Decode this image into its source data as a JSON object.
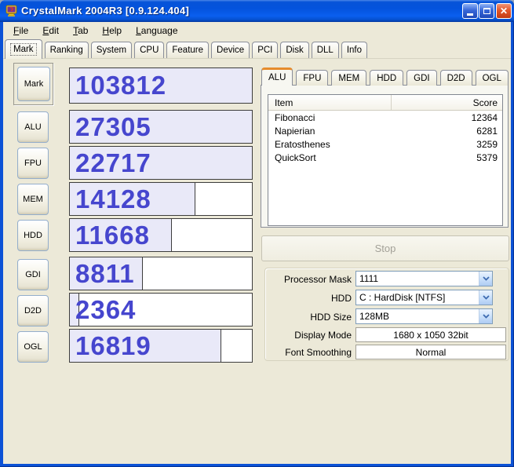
{
  "window": {
    "title": "CrystalMark 2004R3 [0.9.124.404]",
    "icons": {
      "close": "✕"
    }
  },
  "menu": {
    "items": [
      "File",
      "Edit",
      "Tab",
      "Help",
      "Language"
    ]
  },
  "main_tabs": {
    "active": "Mark",
    "items": [
      "Mark",
      "Ranking",
      "System",
      "CPU",
      "Feature",
      "Device",
      "PCI",
      "Disk",
      "DLL",
      "Info"
    ]
  },
  "benchmark": {
    "rows": [
      {
        "id": "mark",
        "label": "Mark",
        "score": "103812",
        "fill_pct": 100
      },
      {
        "id": "alu",
        "label": "ALU",
        "score": "27305",
        "fill_pct": 100
      },
      {
        "id": "fpu",
        "label": "FPU",
        "score": "22717",
        "fill_pct": 100
      },
      {
        "id": "mem",
        "label": "MEM",
        "score": "14128",
        "fill_pct": 69
      },
      {
        "id": "hdd",
        "label": "HDD",
        "score": "11668",
        "fill_pct": 56
      },
      {
        "id": "gdi",
        "label": "GDI",
        "score": "8811",
        "fill_pct": 40
      },
      {
        "id": "d2d",
        "label": "D2D",
        "score": "2364",
        "fill_pct": 5
      },
      {
        "id": "ogl",
        "label": "OGL",
        "score": "16819",
        "fill_pct": 83
      }
    ]
  },
  "detail": {
    "active_tab": "ALU",
    "tabs": [
      "ALU",
      "FPU",
      "MEM",
      "HDD",
      "GDI",
      "D2D",
      "OGL"
    ],
    "table": {
      "columns": [
        "Item",
        "Score"
      ],
      "rows": [
        {
          "item": "Fibonacci",
          "score": "12364"
        },
        {
          "item": "Napierian",
          "score": "6281"
        },
        {
          "item": "Eratosthenes",
          "score": "3259"
        },
        {
          "item": "QuickSort",
          "score": "5379"
        }
      ]
    }
  },
  "stop_button": {
    "label": "Stop",
    "enabled": false
  },
  "settings": {
    "fields": [
      {
        "label": "Processor Mask",
        "value": "1111",
        "type": "combo"
      },
      {
        "label": "HDD",
        "value": "C : HardDisk [NTFS]",
        "type": "combo"
      },
      {
        "label": "HDD Size",
        "value": "128MB",
        "type": "combo"
      },
      {
        "label": "Display Mode",
        "value": "1680 x 1050 32bit",
        "type": "static"
      },
      {
        "label": "Font Smoothing",
        "value": "Normal",
        "type": "static"
      }
    ]
  },
  "colors": {
    "titlebar_blue": "#0453DD",
    "frame_blue": "#0C52D6",
    "client_bg": "#ECE9D8",
    "score_text": "#4646CE",
    "bar_fill": "#E9E9F8",
    "active_tab_accent": "#E68B2C"
  }
}
